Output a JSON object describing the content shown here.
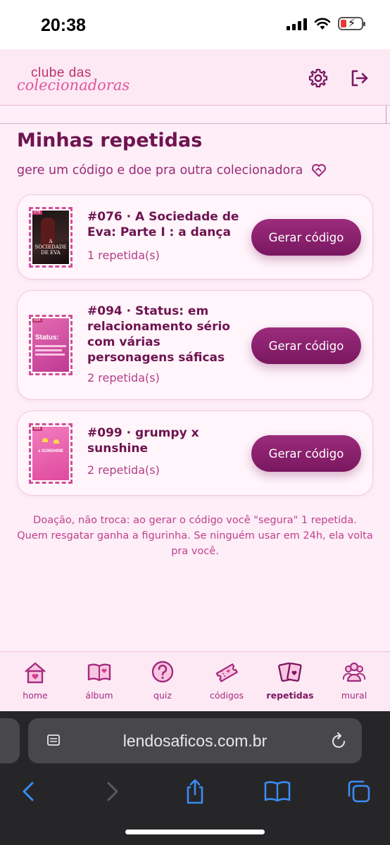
{
  "status_bar": {
    "time": "20:38"
  },
  "header": {
    "logo_top": "clube das",
    "logo_bottom": "colecionadoras",
    "settings_icon": "gear-icon",
    "logout_icon": "logout-icon"
  },
  "main": {
    "title": "Minhas repetidas",
    "subtitle": "gere um código e doe pra outra colecionadora",
    "cards": [
      {
        "title": "#076 · A Sociedade de Eva: Parte I : a dança",
        "count": "1 repetida(s)",
        "button": "Gerar código",
        "thumb_num": "076",
        "thumb_text": "A SOCIEDADE DE EVA"
      },
      {
        "title": "#094 · Status: em relacionamento sério com várias personagens sáficas",
        "count": "2 repetida(s)",
        "button": "Gerar código",
        "thumb_num": "094",
        "thumb_text": "Status:"
      },
      {
        "title": "#099 · grumpy x sunshine",
        "count": "2 repetida(s)",
        "button": "Gerar código",
        "thumb_num": "099",
        "thumb_text": "x SUNSHINE"
      }
    ],
    "info": "Doação, não troca: ao gerar o código você \"segura\" 1 repetida. Quem resgatar ganha a figurinha. Se ninguém usar em 24h, ela volta pra você."
  },
  "bottom_nav": {
    "items": [
      {
        "label": "home",
        "icon": "home-icon"
      },
      {
        "label": "álbum",
        "icon": "album-icon"
      },
      {
        "label": "quiz",
        "icon": "quiz-icon"
      },
      {
        "label": "códigos",
        "icon": "ticket-icon"
      },
      {
        "label": "repetidas",
        "icon": "cards-icon",
        "active": true
      },
      {
        "label": "mural",
        "icon": "people-icon"
      }
    ]
  },
  "browser": {
    "url": "lendosaficos.com.br"
  },
  "colors": {
    "primary": "#7a1760",
    "accent": "#c0306f",
    "background": "#fdeef7"
  }
}
